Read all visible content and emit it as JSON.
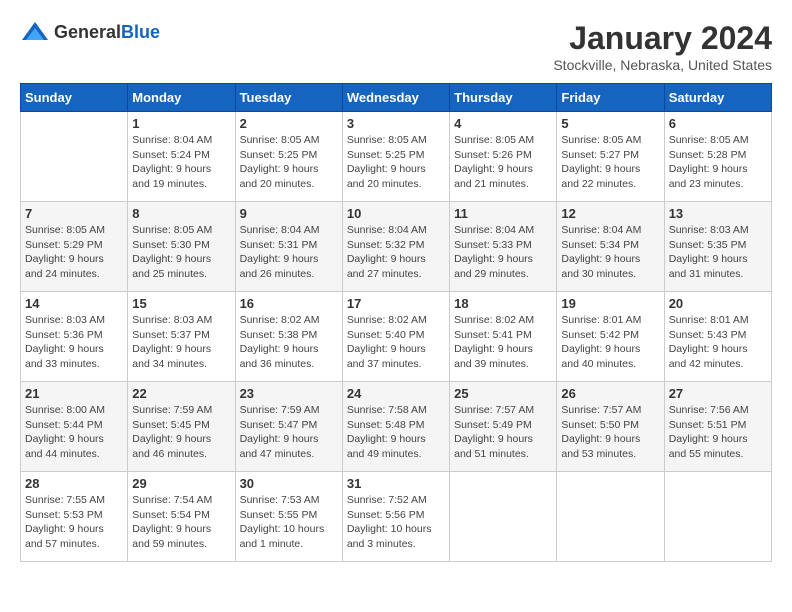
{
  "header": {
    "logo": {
      "general": "General",
      "blue": "Blue"
    },
    "month": "January 2024",
    "location": "Stockville, Nebraska, United States"
  },
  "weekdays": [
    "Sunday",
    "Monday",
    "Tuesday",
    "Wednesday",
    "Thursday",
    "Friday",
    "Saturday"
  ],
  "weeks": [
    [
      {
        "day": "",
        "sunrise": "",
        "sunset": "",
        "daylight": ""
      },
      {
        "day": "1",
        "sunrise": "Sunrise: 8:04 AM",
        "sunset": "Sunset: 5:24 PM",
        "daylight": "Daylight: 9 hours and 19 minutes."
      },
      {
        "day": "2",
        "sunrise": "Sunrise: 8:05 AM",
        "sunset": "Sunset: 5:25 PM",
        "daylight": "Daylight: 9 hours and 20 minutes."
      },
      {
        "day": "3",
        "sunrise": "Sunrise: 8:05 AM",
        "sunset": "Sunset: 5:25 PM",
        "daylight": "Daylight: 9 hours and 20 minutes."
      },
      {
        "day": "4",
        "sunrise": "Sunrise: 8:05 AM",
        "sunset": "Sunset: 5:26 PM",
        "daylight": "Daylight: 9 hours and 21 minutes."
      },
      {
        "day": "5",
        "sunrise": "Sunrise: 8:05 AM",
        "sunset": "Sunset: 5:27 PM",
        "daylight": "Daylight: 9 hours and 22 minutes."
      },
      {
        "day": "6",
        "sunrise": "Sunrise: 8:05 AM",
        "sunset": "Sunset: 5:28 PM",
        "daylight": "Daylight: 9 hours and 23 minutes."
      }
    ],
    [
      {
        "day": "7",
        "sunrise": "Sunrise: 8:05 AM",
        "sunset": "Sunset: 5:29 PM",
        "daylight": "Daylight: 9 hours and 24 minutes."
      },
      {
        "day": "8",
        "sunrise": "Sunrise: 8:05 AM",
        "sunset": "Sunset: 5:30 PM",
        "daylight": "Daylight: 9 hours and 25 minutes."
      },
      {
        "day": "9",
        "sunrise": "Sunrise: 8:04 AM",
        "sunset": "Sunset: 5:31 PM",
        "daylight": "Daylight: 9 hours and 26 minutes."
      },
      {
        "day": "10",
        "sunrise": "Sunrise: 8:04 AM",
        "sunset": "Sunset: 5:32 PM",
        "daylight": "Daylight: 9 hours and 27 minutes."
      },
      {
        "day": "11",
        "sunrise": "Sunrise: 8:04 AM",
        "sunset": "Sunset: 5:33 PM",
        "daylight": "Daylight: 9 hours and 29 minutes."
      },
      {
        "day": "12",
        "sunrise": "Sunrise: 8:04 AM",
        "sunset": "Sunset: 5:34 PM",
        "daylight": "Daylight: 9 hours and 30 minutes."
      },
      {
        "day": "13",
        "sunrise": "Sunrise: 8:03 AM",
        "sunset": "Sunset: 5:35 PM",
        "daylight": "Daylight: 9 hours and 31 minutes."
      }
    ],
    [
      {
        "day": "14",
        "sunrise": "Sunrise: 8:03 AM",
        "sunset": "Sunset: 5:36 PM",
        "daylight": "Daylight: 9 hours and 33 minutes."
      },
      {
        "day": "15",
        "sunrise": "Sunrise: 8:03 AM",
        "sunset": "Sunset: 5:37 PM",
        "daylight": "Daylight: 9 hours and 34 minutes."
      },
      {
        "day": "16",
        "sunrise": "Sunrise: 8:02 AM",
        "sunset": "Sunset: 5:38 PM",
        "daylight": "Daylight: 9 hours and 36 minutes."
      },
      {
        "day": "17",
        "sunrise": "Sunrise: 8:02 AM",
        "sunset": "Sunset: 5:40 PM",
        "daylight": "Daylight: 9 hours and 37 minutes."
      },
      {
        "day": "18",
        "sunrise": "Sunrise: 8:02 AM",
        "sunset": "Sunset: 5:41 PM",
        "daylight": "Daylight: 9 hours and 39 minutes."
      },
      {
        "day": "19",
        "sunrise": "Sunrise: 8:01 AM",
        "sunset": "Sunset: 5:42 PM",
        "daylight": "Daylight: 9 hours and 40 minutes."
      },
      {
        "day": "20",
        "sunrise": "Sunrise: 8:01 AM",
        "sunset": "Sunset: 5:43 PM",
        "daylight": "Daylight: 9 hours and 42 minutes."
      }
    ],
    [
      {
        "day": "21",
        "sunrise": "Sunrise: 8:00 AM",
        "sunset": "Sunset: 5:44 PM",
        "daylight": "Daylight: 9 hours and 44 minutes."
      },
      {
        "day": "22",
        "sunrise": "Sunrise: 7:59 AM",
        "sunset": "Sunset: 5:45 PM",
        "daylight": "Daylight: 9 hours and 46 minutes."
      },
      {
        "day": "23",
        "sunrise": "Sunrise: 7:59 AM",
        "sunset": "Sunset: 5:47 PM",
        "daylight": "Daylight: 9 hours and 47 minutes."
      },
      {
        "day": "24",
        "sunrise": "Sunrise: 7:58 AM",
        "sunset": "Sunset: 5:48 PM",
        "daylight": "Daylight: 9 hours and 49 minutes."
      },
      {
        "day": "25",
        "sunrise": "Sunrise: 7:57 AM",
        "sunset": "Sunset: 5:49 PM",
        "daylight": "Daylight: 9 hours and 51 minutes."
      },
      {
        "day": "26",
        "sunrise": "Sunrise: 7:57 AM",
        "sunset": "Sunset: 5:50 PM",
        "daylight": "Daylight: 9 hours and 53 minutes."
      },
      {
        "day": "27",
        "sunrise": "Sunrise: 7:56 AM",
        "sunset": "Sunset: 5:51 PM",
        "daylight": "Daylight: 9 hours and 55 minutes."
      }
    ],
    [
      {
        "day": "28",
        "sunrise": "Sunrise: 7:55 AM",
        "sunset": "Sunset: 5:53 PM",
        "daylight": "Daylight: 9 hours and 57 minutes."
      },
      {
        "day": "29",
        "sunrise": "Sunrise: 7:54 AM",
        "sunset": "Sunset: 5:54 PM",
        "daylight": "Daylight: 9 hours and 59 minutes."
      },
      {
        "day": "30",
        "sunrise": "Sunrise: 7:53 AM",
        "sunset": "Sunset: 5:55 PM",
        "daylight": "Daylight: 10 hours and 1 minute."
      },
      {
        "day": "31",
        "sunrise": "Sunrise: 7:52 AM",
        "sunset": "Sunset: 5:56 PM",
        "daylight": "Daylight: 10 hours and 3 minutes."
      },
      {
        "day": "",
        "sunrise": "",
        "sunset": "",
        "daylight": ""
      },
      {
        "day": "",
        "sunrise": "",
        "sunset": "",
        "daylight": ""
      },
      {
        "day": "",
        "sunrise": "",
        "sunset": "",
        "daylight": ""
      }
    ]
  ]
}
